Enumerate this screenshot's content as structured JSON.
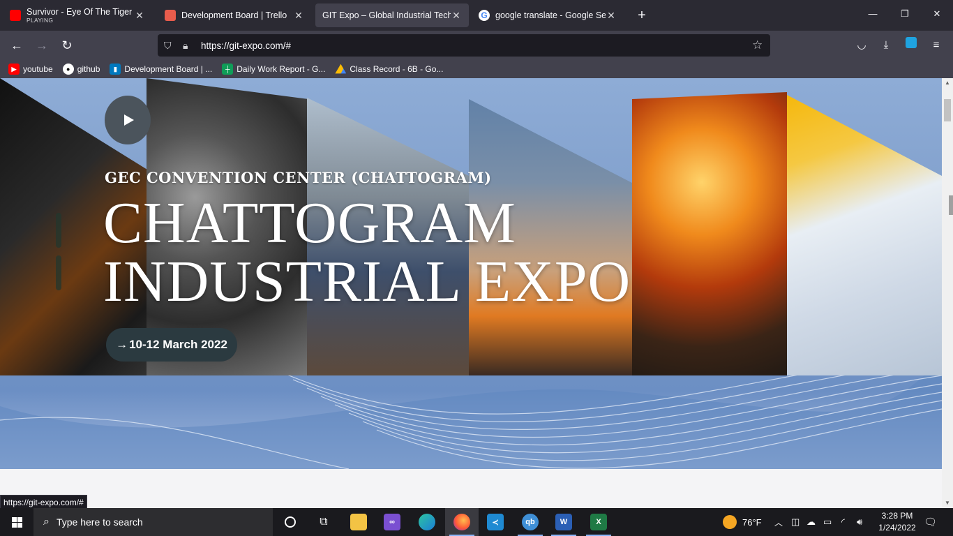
{
  "browser": {
    "tabs": [
      {
        "title": "Survivor - Eye Of The Tiger (Offi",
        "subtitle": "PLAYING",
        "favicon": "youtube-icon",
        "color": "#ff0000",
        "active": false
      },
      {
        "title": "Development Board | Trello",
        "favicon": "trello-icon",
        "color": "#e95c4c",
        "active": false
      },
      {
        "title": "GIT Expo – Global Industrial Technol",
        "favicon": "none",
        "active": true
      },
      {
        "title": "google translate - Google Searc",
        "favicon": "google-icon",
        "color": "#4285f4",
        "active": false
      }
    ],
    "new_tab_label": "+",
    "url": "https://git-expo.com/#",
    "bookmarks": [
      {
        "label": "youtube",
        "icon": "youtube-icon",
        "color": "#ff0000"
      },
      {
        "label": "github",
        "icon": "github-icon",
        "color": "#ffffff"
      },
      {
        "label": "Development Board | ...",
        "icon": "trello-icon",
        "color": "#0079bf"
      },
      {
        "label": "Daily Work Report - G...",
        "icon": "sheets-icon",
        "color": "#0f9d58"
      },
      {
        "label": "Class Record - 6B - Go...",
        "icon": "drive-icon",
        "color": "#fbbc04"
      }
    ]
  },
  "hero": {
    "venue": "GEC CONVENTION CENTER (CHATTOGRAM)",
    "title_line1": "CHATTOGRAM",
    "title_line2": "INDUSTRIAL EXPO",
    "date_button": "10-12 March 2022"
  },
  "status_tooltip": "https://git-expo.com/#",
  "taskbar": {
    "search_placeholder": "Type here to search",
    "weather": "76°F",
    "time": "3:28 PM",
    "date": "1/24/2022"
  }
}
